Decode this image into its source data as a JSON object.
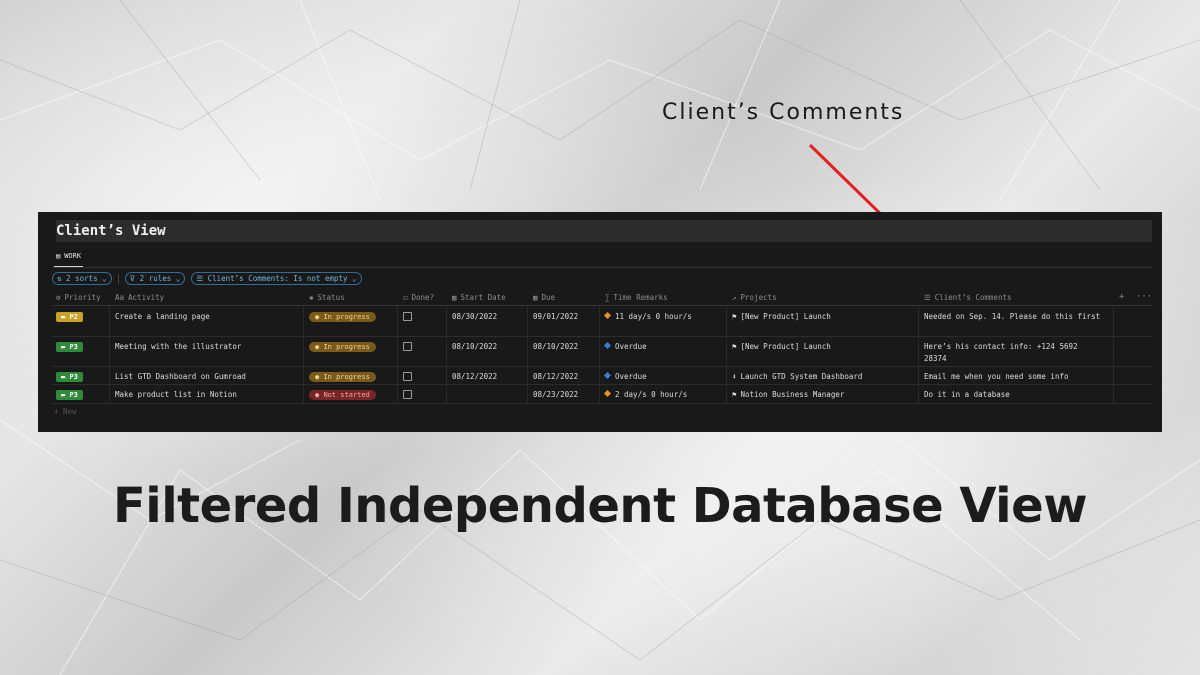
{
  "callout": {
    "text": "Client’s Comments"
  },
  "headline": "Filtered Independent Database View",
  "colors": {
    "panel_bg": "#191919",
    "arrow": "#e52020",
    "filter_chip": "#6fb6dc",
    "p2": "#c9a227",
    "p3": "#2e8b3a",
    "in_progress": "#7a5a1a",
    "not_started": "#7a2525"
  },
  "view": {
    "title": "Client’s View",
    "tab": "WORK",
    "tab_icon": "table-icon",
    "filters": [
      "⇅ 2 sorts ⌄",
      "⊽ 2 rules ⌄",
      "☰ Client’s Comments: Is not empty ⌄"
    ],
    "columns": [
      {
        "key": "priority",
        "label": "Priority",
        "icon": "⚙"
      },
      {
        "key": "activity",
        "label": "Activity",
        "icon": "Aa"
      },
      {
        "key": "status",
        "label": "Status",
        "icon": "✺"
      },
      {
        "key": "done",
        "label": "Done?",
        "icon": "☑"
      },
      {
        "key": "start",
        "label": "Start Date",
        "icon": "▦"
      },
      {
        "key": "due",
        "label": "Due",
        "icon": "▦"
      },
      {
        "key": "time",
        "label": "Time Remarks",
        "icon": "∑"
      },
      {
        "key": "projects",
        "label": "Projects",
        "icon": "↗"
      },
      {
        "key": "comments",
        "label": "Client’s Comments",
        "icon": "☰"
      }
    ],
    "header_actions": [
      "+",
      "···"
    ],
    "rows": [
      {
        "priority": "P2",
        "activity": "Create a landing page",
        "status": "In progress",
        "done": false,
        "start": "08/30/2022",
        "due": "09/01/2022",
        "time_icon": "orange",
        "time": "11 day/s 0 hour/s",
        "project_icon": "⚑",
        "project": "[New Product] Launch",
        "comment": "Needed on Sep. 14. Please do this first"
      },
      {
        "priority": "P3",
        "activity": "Meeting with the illustrator",
        "status": "In progress",
        "done": false,
        "start": "08/10/2022",
        "due": "08/10/2022",
        "time_icon": "blue",
        "time": "Overdue",
        "project_icon": "⚑",
        "project": "[New Product] Launch",
        "comment": "Here’s his contact info: +124 5692 28374"
      },
      {
        "priority": "P3",
        "activity": "List GTD Dashboard on Gumroad",
        "status": "In progress",
        "done": false,
        "start": "08/12/2022",
        "due": "08/12/2022",
        "time_icon": "blue",
        "time": "Overdue",
        "project_icon": "⬇",
        "project": "Launch GTD System Dashboard",
        "comment": "Email me when you need some info"
      },
      {
        "priority": "P3",
        "activity": "Make product list in Notion",
        "status": "Not started",
        "done": false,
        "start": "",
        "due": "08/23/2022",
        "time_icon": "orange",
        "time": "2 day/s 0 hour/s",
        "project_icon": "⚑",
        "project": "Notion Business Manager",
        "comment": "Do it in a database"
      }
    ],
    "new_label": "+ New"
  }
}
